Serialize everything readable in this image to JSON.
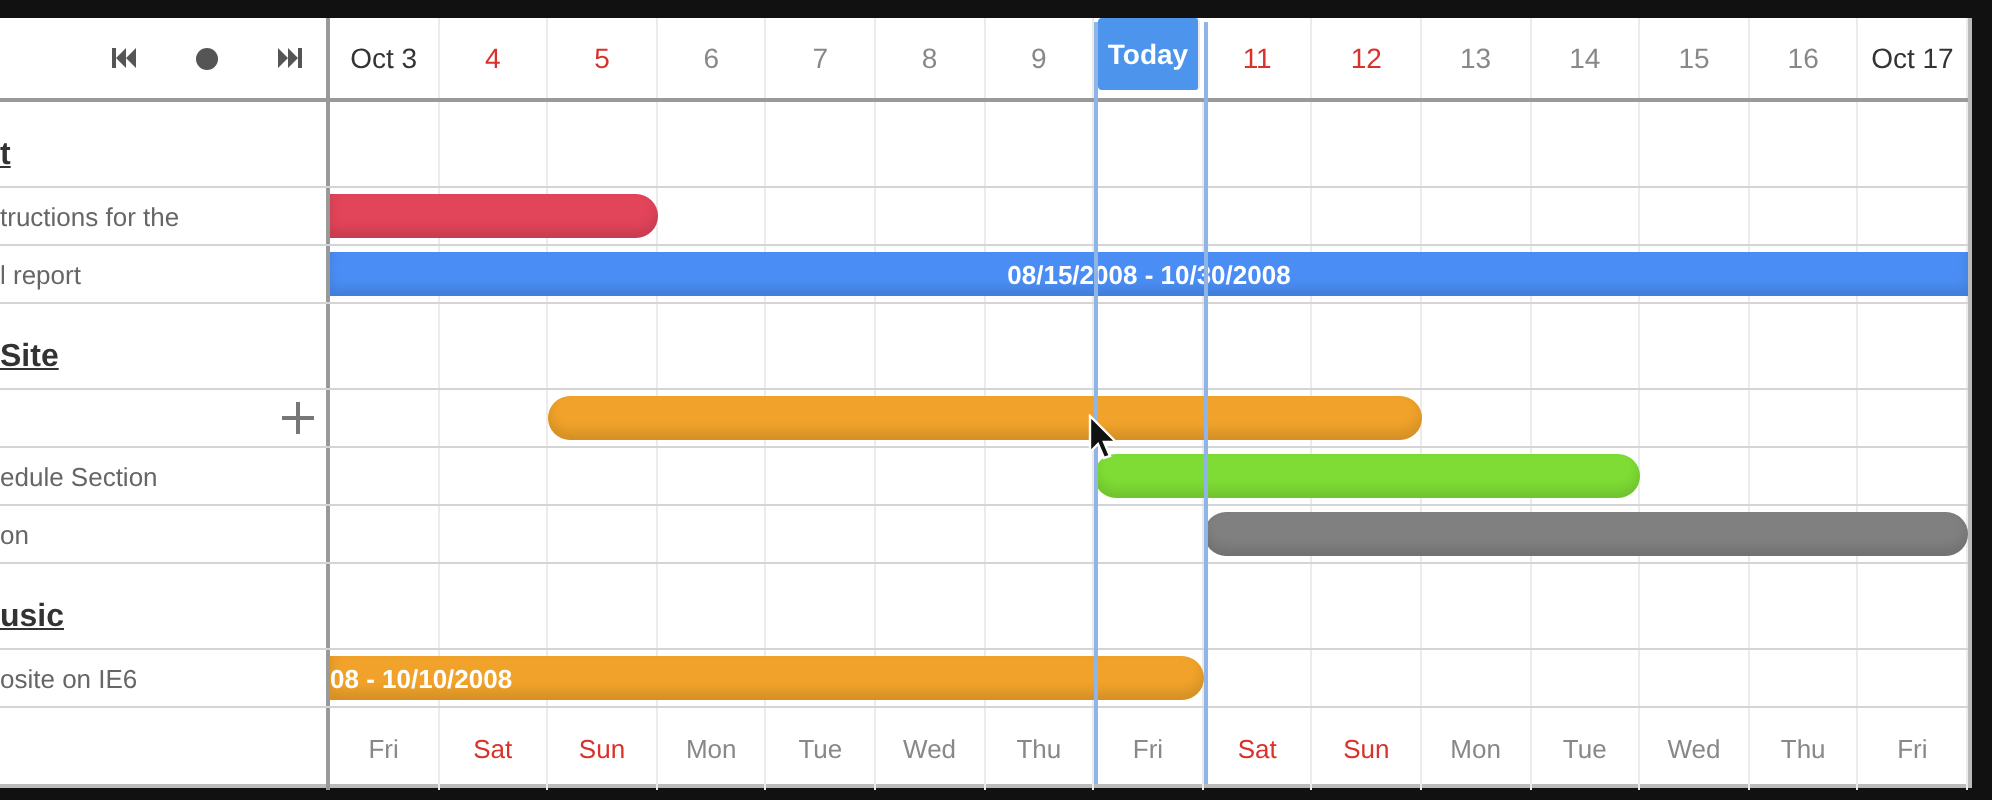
{
  "toolbar": {
    "buttons": [
      {
        "kind": "first"
      },
      {
        "kind": "current"
      },
      {
        "kind": "last"
      }
    ]
  },
  "days": [
    {
      "label": "Oct 3",
      "kind": "month"
    },
    {
      "label": "4",
      "kind": "weekend"
    },
    {
      "label": "5",
      "kind": "weekend"
    },
    {
      "label": "6",
      "kind": "weekday"
    },
    {
      "label": "7",
      "kind": "weekday"
    },
    {
      "label": "8",
      "kind": "weekday"
    },
    {
      "label": "9",
      "kind": "weekday"
    },
    {
      "label": "Today",
      "kind": "today"
    },
    {
      "label": "11",
      "kind": "weekend"
    },
    {
      "label": "12",
      "kind": "weekend"
    },
    {
      "label": "13",
      "kind": "weekday"
    },
    {
      "label": "14",
      "kind": "weekday"
    },
    {
      "label": "15",
      "kind": "weekday"
    },
    {
      "label": "16",
      "kind": "weekday"
    },
    {
      "label": "Oct 17",
      "kind": "month"
    }
  ],
  "rows": [
    {
      "kind": "group",
      "label": "t"
    },
    {
      "kind": "task",
      "label": "tructions for the",
      "bar": {
        "covers": [
          true,
          true,
          true,
          false,
          false,
          false,
          false,
          false,
          false,
          false,
          false,
          false,
          false,
          false,
          false
        ],
        "color": "#e2445a",
        "open_start": true,
        "open_end": false
      }
    },
    {
      "kind": "task",
      "label": "l report",
      "bar": {
        "covers": [
          true,
          true,
          true,
          true,
          true,
          true,
          true,
          true,
          true,
          true,
          true,
          true,
          true,
          true,
          true
        ],
        "color": "#4a8ef5",
        "open_start": true,
        "open_end": true,
        "label": "08/15/2008 - 10/30/2008"
      }
    },
    {
      "kind": "group",
      "label": "Site"
    },
    {
      "kind": "task",
      "add_button": true,
      "bar": {
        "covers": [
          false,
          false,
          true,
          true,
          true,
          true,
          true,
          true,
          true,
          true,
          false,
          false,
          false,
          false,
          false
        ],
        "color": "#f0a22a",
        "open_start": false,
        "open_end": false
      }
    },
    {
      "kind": "task",
      "label": "edule Section",
      "bar": {
        "covers": [
          false,
          false,
          false,
          false,
          false,
          false,
          false,
          true,
          true,
          true,
          true,
          true,
          false,
          false,
          false
        ],
        "color": "#7edc34",
        "open_start": false,
        "open_end": false
      }
    },
    {
      "kind": "task",
      "label": "on",
      "bar": {
        "covers": [
          false,
          false,
          false,
          false,
          false,
          false,
          false,
          false,
          true,
          true,
          true,
          true,
          true,
          true,
          true
        ],
        "color": "#808080",
        "open_start": false,
        "open_end": false
      }
    },
    {
      "kind": "group",
      "label": "usic"
    },
    {
      "kind": "task",
      "label": "osite on IE6",
      "bar": {
        "covers": [
          true,
          true,
          true,
          true,
          true,
          true,
          true,
          true,
          false,
          false,
          false,
          false,
          false,
          false,
          false
        ],
        "color": "#f0a22a",
        "open_start": true,
        "open_end": false,
        "label": "08 - 10/10/2008"
      }
    }
  ],
  "weekdays": [
    {
      "label": "Fri",
      "weekend": false
    },
    {
      "label": "Sat",
      "weekend": true
    },
    {
      "label": "Sun",
      "weekend": true
    },
    {
      "label": "Mon",
      "weekend": false
    },
    {
      "label": "Tue",
      "weekend": false
    },
    {
      "label": "Wed",
      "weekend": false
    },
    {
      "label": "Thu",
      "weekend": false
    },
    {
      "label": "Fri",
      "weekend": false
    },
    {
      "label": "Sat",
      "weekend": true
    },
    {
      "label": "Sun",
      "weekend": true
    },
    {
      "label": "Mon",
      "weekend": false
    },
    {
      "label": "Tue",
      "weekend": false
    },
    {
      "label": "Wed",
      "weekend": false
    },
    {
      "label": "Thu",
      "weekend": false
    },
    {
      "label": "Fri",
      "weekend": false
    }
  ]
}
